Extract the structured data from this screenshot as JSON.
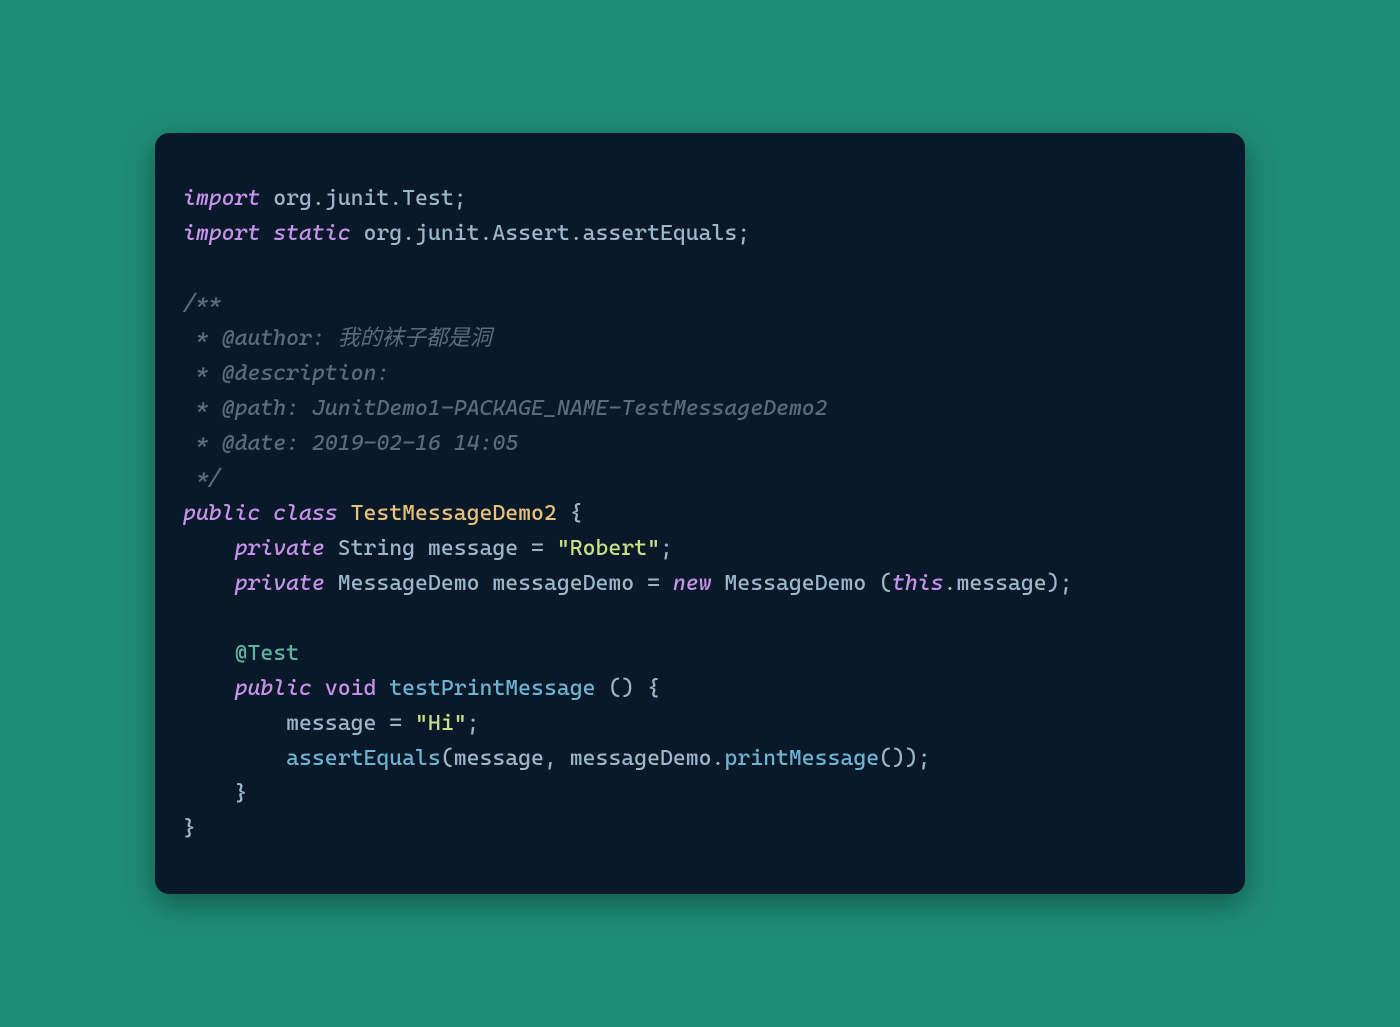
{
  "code": {
    "line1": {
      "kw": "import",
      "pkg": "org.junit.Test",
      "semi": ";"
    },
    "line2": {
      "kw1": "import",
      "kw2": "static",
      "pkg": "org.junit.Assert.assertEquals",
      "semi": ";"
    },
    "comment": {
      "open": "/**",
      "l1": " * @author: 我的袜子都是洞",
      "l2": " * @description:",
      "l3": " * @path: JunitDemo1-PACKAGE_NAME-TestMessageDemo2",
      "l4": " * @date: 2019-02-16 14:05",
      "close": " */"
    },
    "classline": {
      "kw1": "public",
      "kw2": "class",
      "name": "TestMessageDemo2",
      "brace": " {"
    },
    "field1": {
      "indent": "    ",
      "kw": "private",
      "type": "String",
      "name": "message",
      "eq": " = ",
      "val": "\"Robert\"",
      "semi": ";"
    },
    "field2": {
      "indent": "    ",
      "kw": "private",
      "type": "MessageDemo",
      "name": "messageDemo",
      "eq": " = ",
      "newkw": "new",
      "ctor": "MessageDemo",
      "open": " (",
      "thiskw": "this",
      "dot": ".",
      "arg": "message",
      "close": ");"
    },
    "anno": {
      "indent": "    ",
      "text": "@Test"
    },
    "method": {
      "indent": "    ",
      "kw1": "public",
      "kw2": "void",
      "name": "testPrintMessage",
      "sig": " () {"
    },
    "body1": {
      "indent": "        ",
      "lhs": "message",
      "eq": " = ",
      "val": "\"Hi\"",
      "semi": ";"
    },
    "body2": {
      "indent": "        ",
      "fn": "assertEquals",
      "open": "(",
      "arg1": "message",
      "comma": ", ",
      "arg2a": "messageDemo",
      "dot": ".",
      "arg2b": "printMessage",
      "call": "());"
    },
    "closeMethod": "    }",
    "closeClass": "}"
  }
}
